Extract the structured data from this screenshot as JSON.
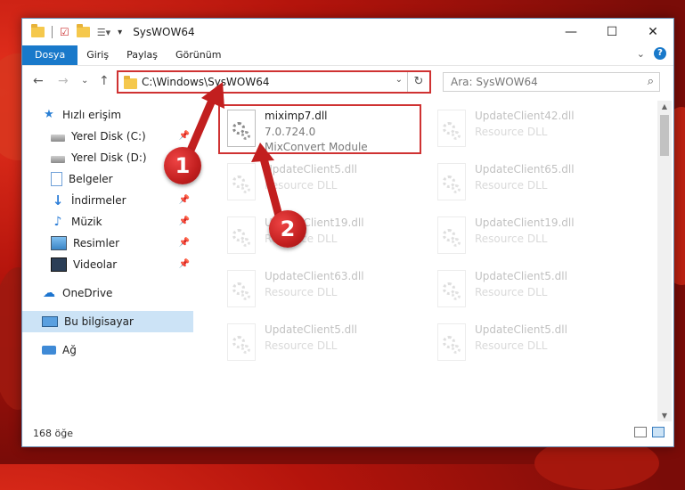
{
  "window": {
    "title": "SysWOW64",
    "controls": {
      "minimize": "—",
      "maximize": "☐",
      "close": "✕"
    }
  },
  "ribbon": {
    "tabs": [
      "Dosya",
      "Giriş",
      "Paylaş",
      "Görünüm"
    ],
    "active_tab": "Dosya",
    "help": "?"
  },
  "nav": {
    "address_path": "C:\\Windows\\SysWOW64",
    "search_placeholder": "Ara: SysWOW64"
  },
  "sidebar": {
    "items": [
      {
        "label": "Hızlı erişim",
        "icon": "star-icon",
        "pinned": false
      },
      {
        "label": "Yerel Disk (C:)",
        "icon": "drive-icon",
        "pinned": true
      },
      {
        "label": "Yerel Disk (D:)",
        "icon": "drive-icon",
        "pinned": false
      },
      {
        "label": "Belgeler",
        "icon": "document-icon",
        "pinned": true
      },
      {
        "label": "İndirmeler",
        "icon": "download-icon",
        "pinned": true
      },
      {
        "label": "Müzik",
        "icon": "music-icon",
        "pinned": true
      },
      {
        "label": "Resimler",
        "icon": "pictures-icon",
        "pinned": true
      },
      {
        "label": "Videolar",
        "icon": "video-icon",
        "pinned": true
      },
      {
        "label": "OneDrive",
        "icon": "cloud-icon",
        "pinned": false
      },
      {
        "label": "Bu bilgisayar",
        "icon": "computer-icon",
        "pinned": false,
        "selected": true
      },
      {
        "label": "Ağ",
        "icon": "network-icon",
        "pinned": false
      }
    ]
  },
  "files": [
    {
      "name": "miximp7.dll",
      "line2": "7.0.724.0",
      "line3": "MixConvert Module",
      "highlight": true
    },
    {
      "name": "UpdateClient42.dll",
      "line2": "Resource DLL"
    },
    {
      "name": "UpdateClient5.dll",
      "line2": "Resource DLL"
    },
    {
      "name": "UpdateClient65.dll",
      "line2": "Resource DLL"
    },
    {
      "name": "UpdateClient19.dll",
      "line2": "Resource DLL"
    },
    {
      "name": "UpdateClient19.dll",
      "line2": "Resource DLL"
    },
    {
      "name": "UpdateClient63.dll",
      "line2": "Resource DLL"
    },
    {
      "name": "UpdateClient5.dll",
      "line2": "Resource DLL"
    },
    {
      "name": "UpdateClient5.dll",
      "line2": "Resource DLL"
    },
    {
      "name": "UpdateClient5.dll",
      "line2": "Resource DLL"
    }
  ],
  "status": {
    "item_count": "168 öğe"
  },
  "annotations": {
    "step1": "1",
    "step2": "2"
  },
  "colors": {
    "accent": "#1979ca",
    "highlight": "#cf3232"
  }
}
